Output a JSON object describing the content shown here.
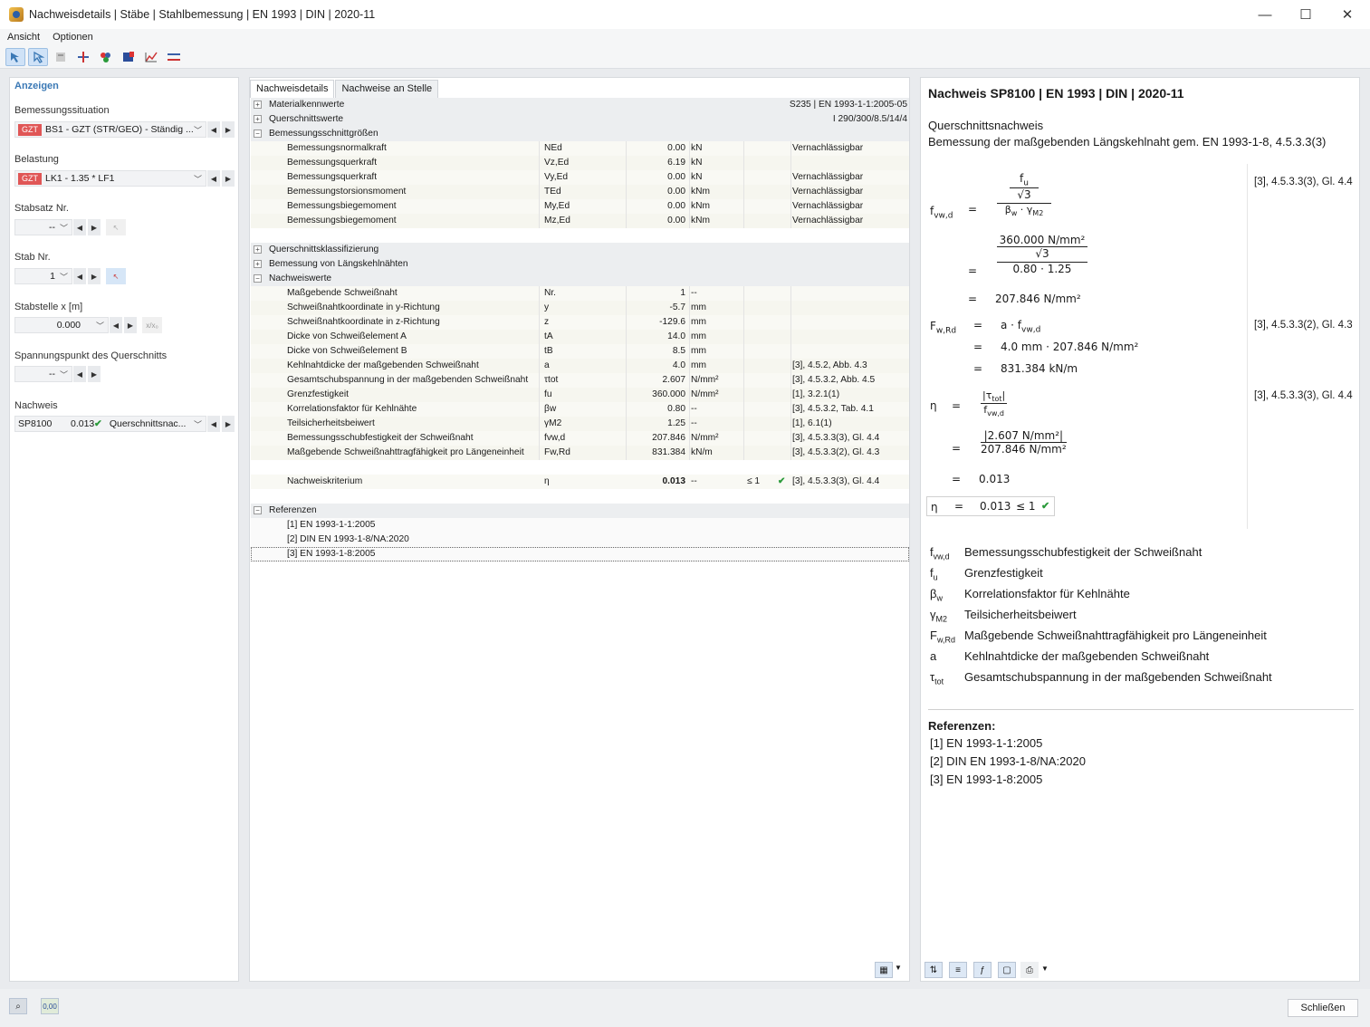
{
  "window": {
    "title": "Nachweisdetails | Stäbe | Stahlbemessung | EN 1993 | DIN | 2020-11",
    "minimize": "—",
    "maximize": "☐",
    "close": "✕"
  },
  "menu": [
    "Ansicht",
    "Optionen"
  ],
  "toolbar_icons": [
    "select-icon",
    "select-alt-icon",
    "table-icon",
    "member-icon",
    "colors-icon",
    "result-icon",
    "diagram-icon",
    "section-icon"
  ],
  "left": {
    "header": "Anzeigen",
    "situation_label": "Bemessungssituation",
    "situation_tag": "GZT",
    "situation_value": "BS1 - GZT (STR/GEO) - Ständig ...",
    "load_label": "Belastung",
    "load_tag": "GZT",
    "load_value": "LK1 - 1.35 * LF1",
    "set_label": "Stabsatz Nr.",
    "set_value": "--",
    "member_label": "Stab Nr.",
    "member_value": "1",
    "loc_label": "Stabstelle x [m]",
    "loc_value": "0.000",
    "loc_btn": "x/x₀",
    "stress_label": "Spannungspunkt des Querschnitts",
    "stress_value": "--",
    "check_label": "Nachweis",
    "check_id": "SP8100",
    "check_ratio": "0.013",
    "check_type": "Querschnittsnac..."
  },
  "middle": {
    "tabs": [
      "Nachweisdetails",
      "Nachweise an Stelle"
    ],
    "groups": [
      {
        "title": "Materialkennwerte",
        "right": "S235 | EN 1993-1-1:2005-05",
        "state": "+"
      },
      {
        "title": "Querschnittswerte",
        "right": "I 290/300/8.5/14/4",
        "state": "+"
      }
    ],
    "bsg": {
      "title": "Bemessungsschnittgrößen",
      "state": "−",
      "rows": [
        {
          "name": "Bemessungsnormalkraft",
          "sym": "NEd",
          "val": "0.00",
          "unit": "kN",
          "ref": "Vernachlässigbar"
        },
        {
          "name": "Bemessungsquerkraft",
          "sym": "Vz,Ed",
          "val": "6.19",
          "unit": "kN",
          "ref": ""
        },
        {
          "name": "Bemessungsquerkraft",
          "sym": "Vy,Ed",
          "val": "0.00",
          "unit": "kN",
          "ref": "Vernachlässigbar"
        },
        {
          "name": "Bemessungstorsionsmoment",
          "sym": "TEd",
          "val": "0.00",
          "unit": "kNm",
          "ref": "Vernachlässigbar"
        },
        {
          "name": "Bemessungsbiegemoment",
          "sym": "My,Ed",
          "val": "0.00",
          "unit": "kNm",
          "ref": "Vernachlässigbar"
        },
        {
          "name": "Bemessungsbiegemoment",
          "sym": "Mz,Ed",
          "val": "0.00",
          "unit": "kNm",
          "ref": "Vernachlässigbar"
        }
      ]
    },
    "groups2": [
      {
        "title": "Querschnittsklassifizierung",
        "state": "+"
      },
      {
        "title": "Bemessung von Längskehlnähten",
        "state": "+"
      }
    ],
    "nw": {
      "title": "Nachweiswerte",
      "state": "−",
      "rows": [
        {
          "name": "Maßgebende Schweißnaht",
          "sym": "Nr.",
          "val": "1",
          "unit": "--",
          "ref": ""
        },
        {
          "name": "Schweißnahtkoordinate in y-Richtung",
          "sym": "y",
          "val": "-5.7",
          "unit": "mm",
          "ref": ""
        },
        {
          "name": "Schweißnahtkoordinate in z-Richtung",
          "sym": "z",
          "val": "-129.6",
          "unit": "mm",
          "ref": ""
        },
        {
          "name": "Dicke von Schweißelement A",
          "sym": "tA",
          "val": "14.0",
          "unit": "mm",
          "ref": ""
        },
        {
          "name": "Dicke von Schweißelement B",
          "sym": "tB",
          "val": "8.5",
          "unit": "mm",
          "ref": ""
        },
        {
          "name": "Kehlnahtdicke der maßgebenden Schweißnaht",
          "sym": "a",
          "val": "4.0",
          "unit": "mm",
          "ref": "[3], 4.5.2, Abb. 4.3"
        },
        {
          "name": "Gesamtschubspannung in der maßgebenden Schweißnaht",
          "sym": "τtot",
          "val": "2.607",
          "unit": "N/mm²",
          "ref": "[3], 4.5.3.2, Abb. 4.5"
        },
        {
          "name": "Grenzfestigkeit",
          "sym": "fu",
          "val": "360.000",
          "unit": "N/mm²",
          "ref": "[1], 3.2.1(1)"
        },
        {
          "name": "Korrelationsfaktor für Kehlnähte",
          "sym": "βw",
          "val": "0.80",
          "unit": "--",
          "ref": "[3], 4.5.3.2, Tab. 4.1"
        },
        {
          "name": "Teilsicherheitsbeiwert",
          "sym": "γM2",
          "val": "1.25",
          "unit": "--",
          "ref": "[1], 6.1(1)"
        },
        {
          "name": "Bemessungsschubfestigkeit der Schweißnaht",
          "sym": "fvw,d",
          "val": "207.846",
          "unit": "N/mm²",
          "ref": "[3], 4.5.3.3(3), Gl. 4.4"
        },
        {
          "name": "Maßgebende Schweißnahttragfähigkeit pro Längeneinheit",
          "sym": "Fw,Rd",
          "val": "831.384",
          "unit": "kN/m",
          "ref": "[3], 4.5.3.3(2), Gl. 4.3"
        }
      ]
    },
    "crit": {
      "name": "Nachweiskriterium",
      "sym": "η",
      "val": "0.013",
      "unit": "--",
      "crit": "≤ 1",
      "ref": "[3], 4.5.3.3(3), Gl. 4.4"
    },
    "refs": {
      "title": "Referenzen",
      "state": "−",
      "items": [
        "[1]  EN 1993-1-1:2005",
        "[2]  DIN EN 1993-1-8/NA:2020",
        "[3]  EN 1993-1-8:2005"
      ]
    }
  },
  "right": {
    "title": "Nachweis SP8100 | EN 1993 | DIN | 2020-11",
    "sub1": "Querschnittsnachweis",
    "sub2": "Bemessung der maßgebenden Längskehlnaht gem. EN 1993-1-8, 4.5.3.3(3)",
    "ref1": "[3], 4.5.3.3(3), Gl. 4.4",
    "ref2": "[3], 4.5.3.3(2), Gl. 4.3",
    "ref3": "[3], 4.5.3.3(3), Gl. 4.4",
    "eq": {
      "f_sym": "f",
      "f_sub": "vw,d",
      "fu": "f",
      "fu_sub": "u",
      "sqrt3": "√3",
      "bw": "β",
      "bw_sub": "w",
      "gm": "γ",
      "gm_sub": "M2",
      "n360": "360.000 N/mm²",
      "dsub": "0.80  ·  1.25",
      "res1": "207.846 N/mm²",
      "F_sym": "F",
      "F_sub": "w,Rd",
      "a_f": "a  ·  f",
      "a_f_sub": "vw,d",
      "subst2": "4.0 mm  ·  207.846 N/mm²",
      "res2": "831.384 kN/m",
      "eta": "η",
      "tau": "|τ",
      "tau_sub": "tot",
      "tau_end": "|",
      "ftot": "f",
      "ftot_sub": "vw,d",
      "n_tau": "|2.607 N/mm²|",
      "d_f": "207.846 N/mm²",
      "res3": "0.013",
      "final_eq": "=",
      "final_val": "0.013",
      "final_crit": "≤ 1"
    },
    "legend": [
      {
        "s": "f",
        "sub": "vw,d",
        "t": "Bemessungsschubfestigkeit der Schweißnaht"
      },
      {
        "s": "f",
        "sub": "u",
        "t": "Grenzfestigkeit"
      },
      {
        "s": "β",
        "sub": "w",
        "t": "Korrelationsfaktor für Kehlnähte"
      },
      {
        "s": "γ",
        "sub": "M2",
        "t": "Teilsicherheitsbeiwert"
      },
      {
        "s": "F",
        "sub": "w,Rd",
        "t": "Maßgebende Schweißnahttragfähigkeit pro Längeneinheit"
      },
      {
        "s": "a",
        "sub": "",
        "t": "Kehlnahtdicke der maßgebenden Schweißnaht"
      },
      {
        "s": "τ",
        "sub": "tot",
        "t": "Gesamtschubspannung in der maßgebenden Schweißnaht"
      }
    ],
    "refs_title": "Referenzen:",
    "refs": [
      "[1]   EN 1993-1-1:2005",
      "[2]   DIN EN 1993-1-8/NA:2020",
      "[3]   EN 1993-1-8:2005"
    ]
  },
  "status": {
    "close_label": "Schließen",
    "decimals_label": "0,00"
  }
}
